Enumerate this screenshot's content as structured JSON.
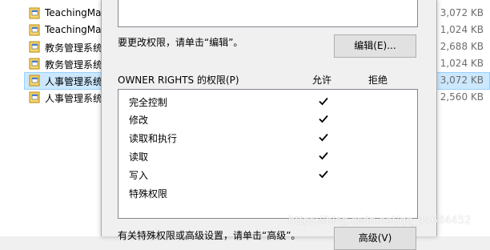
{
  "explorer": {
    "files": [
      {
        "name": "TeachingMa",
        "size": "3,072 KB",
        "selected": false
      },
      {
        "name": "TeachingMa",
        "size": "1,024 KB",
        "selected": false
      },
      {
        "name": "教务管理系统",
        "size": "2,688 KB",
        "selected": false
      },
      {
        "name": "教务管理系统",
        "size": "1,024 KB",
        "selected": false
      },
      {
        "name": "人事管理系统",
        "size": "3,072 KB",
        "selected": true
      },
      {
        "name": "人事管理系统",
        "size": "2,560 KB",
        "selected": false
      }
    ]
  },
  "dialog": {
    "edit_hint": "要更改权限，请单击“编辑”。",
    "edit_button": "编辑(E)...",
    "permissions_title": "OWNER RIGHTS 的权限(P)",
    "allow_label": "允许",
    "deny_label": "拒绝",
    "permissions": [
      {
        "name": "完全控制",
        "allow": true,
        "deny": false
      },
      {
        "name": "修改",
        "allow": true,
        "deny": false
      },
      {
        "name": "读取和执行",
        "allow": true,
        "deny": false
      },
      {
        "name": "读取",
        "allow": true,
        "deny": false
      },
      {
        "name": "写入",
        "allow": true,
        "deny": false
      },
      {
        "name": "特殊权限",
        "allow": false,
        "deny": false
      }
    ],
    "advanced_hint": "有关特殊权限或高级设置，请单击“高级”。",
    "advanced_button": "高级(V)"
  },
  "watermark": "https://blog.csdn.net/qq_44684452",
  "colors": {
    "selection": "#cce8ff",
    "dialog_bg": "#f0f0f0",
    "button_bg": "#e1e1e1",
    "border": "#828790"
  }
}
